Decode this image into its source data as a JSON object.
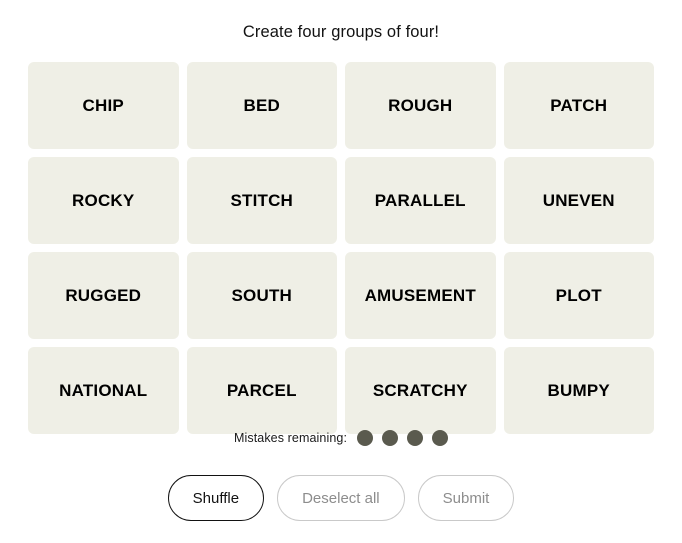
{
  "header": {
    "title": "Create four groups of four!"
  },
  "board": {
    "tiles": [
      {
        "label": "CHIP"
      },
      {
        "label": "BED"
      },
      {
        "label": "ROUGH"
      },
      {
        "label": "PATCH"
      },
      {
        "label": "ROCKY"
      },
      {
        "label": "STITCH"
      },
      {
        "label": "PARALLEL"
      },
      {
        "label": "UNEVEN"
      },
      {
        "label": "RUGGED"
      },
      {
        "label": "SOUTH"
      },
      {
        "label": "AMUSEMENT"
      },
      {
        "label": "PLOT"
      },
      {
        "label": "NATIONAL"
      },
      {
        "label": "PARCEL"
      },
      {
        "label": "SCRATCHY"
      },
      {
        "label": "BUMPY"
      }
    ]
  },
  "mistakes": {
    "label": "Mistakes remaining:",
    "remaining": 4,
    "dot_color": "#5a5a4e"
  },
  "controls": {
    "shuffle_label": "Shuffle",
    "deselect_label": "Deselect all",
    "submit_label": "Submit"
  },
  "colors": {
    "page_background": "#ffffff",
    "tile_background": "#efefe6",
    "tile_text": "#000000",
    "active_button_border": "#121212",
    "disabled_button_border": "#c9c9c9",
    "disabled_button_text": "#8d8d8d"
  }
}
